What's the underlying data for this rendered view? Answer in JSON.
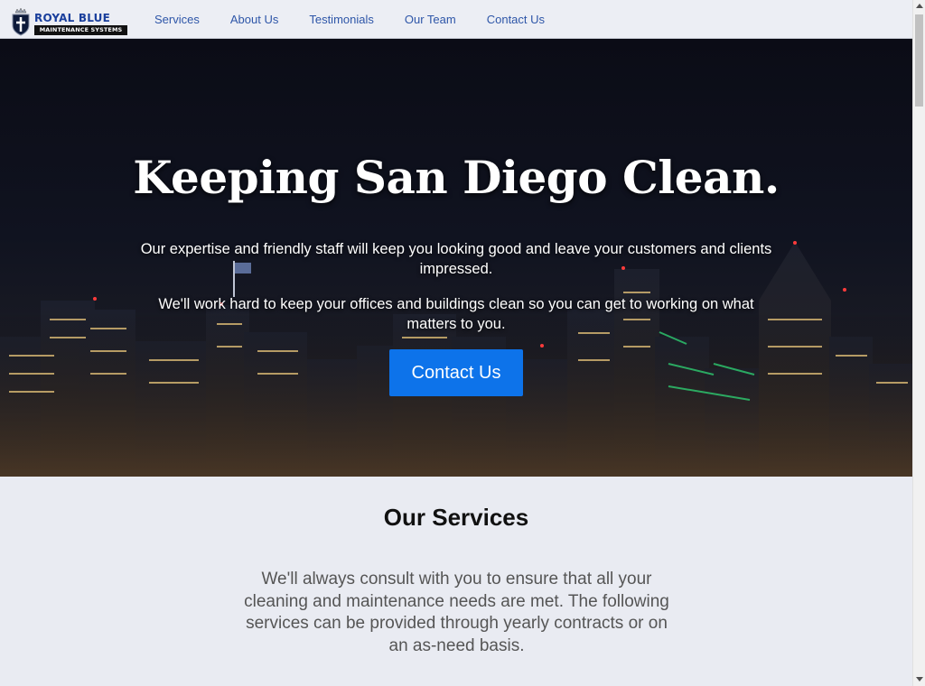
{
  "brand": {
    "name": "ROYAL BLUE",
    "subtitle": "MAINTENANCE SYSTEMS"
  },
  "nav": {
    "items": [
      {
        "label": "Services"
      },
      {
        "label": "About Us"
      },
      {
        "label": "Testimonials"
      },
      {
        "label": "Our Team"
      },
      {
        "label": "Contact Us"
      }
    ]
  },
  "hero": {
    "title": "Keeping San Diego Clean.",
    "paragraph_1": "Our expertise and friendly staff will keep you looking good and leave your customers and clients impressed.",
    "paragraph_2": "We'll work hard to keep your offices and buildings clean so you can get to working on what matters to you.",
    "cta_label": "Contact Us"
  },
  "services": {
    "title": "Our Services",
    "description": "We'll always consult with you to ensure that all your cleaning and maintenance needs are met. The following services can be provided through yearly contracts or on an as-need basis."
  },
  "colors": {
    "link": "#2e56a8",
    "cta_background": "#0d73ea",
    "brand_blue": "#1a3f9c",
    "page_background": "#e9ebf2"
  },
  "icons": {
    "logo": "crowned-shield-icon",
    "scroll_up": "triangle-up-icon",
    "scroll_down": "triangle-down-icon"
  }
}
